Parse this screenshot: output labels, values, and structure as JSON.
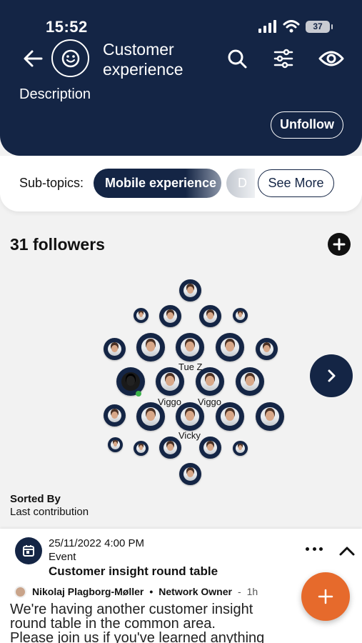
{
  "status_bar": {
    "time": "15:52",
    "battery": "37"
  },
  "header": {
    "title": "Customer experience",
    "description_label": "Description",
    "unfollow_label": "Unfollow",
    "icons": [
      "back-arrow-icon",
      "smiley-icon",
      "search-icon",
      "filter-sliders-icon",
      "eye-icon"
    ]
  },
  "subtopics": {
    "label": "Sub-topics:",
    "chips": [
      "Mobile experience",
      "D"
    ],
    "see_more_label": "See More"
  },
  "followers": {
    "title": "31 followers",
    "visible_names": [
      "Tue Z",
      "Viggo",
      "Viggo",
      "Vicky"
    ]
  },
  "sorting": {
    "label": "Sorted By",
    "value": "Last contribution"
  },
  "feed": {
    "event": {
      "date": "25/11/2022 4:00 PM",
      "type": "Event",
      "title": "Customer insight round table",
      "author": "Nikolaj Plagborg-Møller",
      "separator": "•",
      "author_role": "Network Owner",
      "dash": "-",
      "time_ago": "1h",
      "body_lines": [
        "We're having another customer insight",
        "round table in the common area.",
        "Please join us if you've learned anything"
      ]
    }
  },
  "colors": {
    "navy": "#142545",
    "accent_orange": "#e66a2c",
    "online_green": "#3cb34a"
  }
}
